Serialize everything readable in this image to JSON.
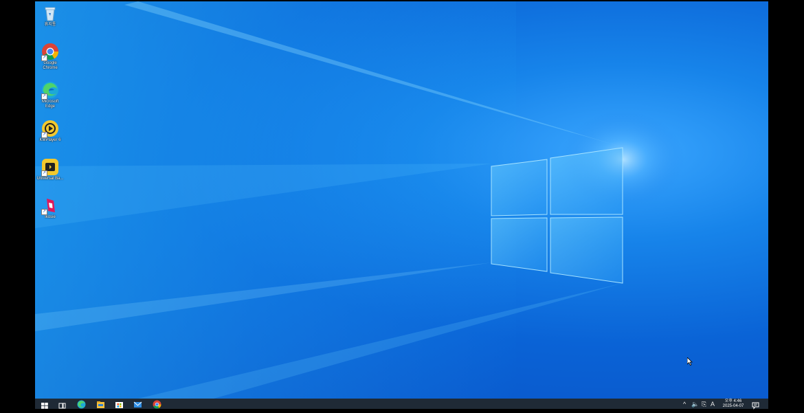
{
  "desktop": {
    "icons": [
      {
        "label": "휴지통",
        "icon": "recycle-bin-icon"
      },
      {
        "label": "Google Chrome",
        "icon": "chrome-icon"
      },
      {
        "label": "Microsoft Edge",
        "icon": "edge-icon"
      },
      {
        "label": "KMPlayer 6",
        "icon": "kmplayer-icon"
      },
      {
        "label": "Universal Ba...",
        "icon": "universal-app-icon"
      },
      {
        "label": "Ikosie",
        "icon": "ikosie-icon"
      }
    ]
  },
  "taskbar": {
    "buttons": [
      {
        "name": "start-button",
        "icon": "windows-logo-icon"
      },
      {
        "name": "task-view-button",
        "icon": "task-view-icon"
      },
      {
        "name": "edge-taskbar-button",
        "icon": "edge-icon"
      },
      {
        "name": "file-explorer-taskbar-button",
        "icon": "folder-icon"
      },
      {
        "name": "store-taskbar-button",
        "icon": "store-icon"
      },
      {
        "name": "mail-taskbar-button",
        "icon": "mail-icon"
      },
      {
        "name": "chrome-taskbar-button",
        "icon": "chrome-icon"
      }
    ],
    "tray": {
      "chevron": "^",
      "volume": "🔈",
      "network": "⎘",
      "ime": "A",
      "time": "오후 4:46",
      "date": "2025-04-07",
      "notification_icon": "notification-icon"
    }
  },
  "colors": {
    "taskbar": "#1f2a36",
    "wallpaper_light": "#3aa6ff",
    "wallpaper_dark": "#0a4fc3"
  }
}
